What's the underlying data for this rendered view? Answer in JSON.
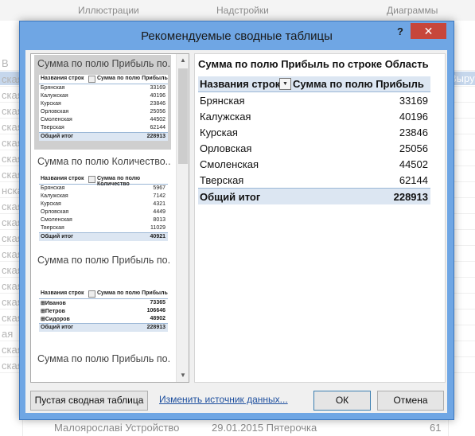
{
  "background": {
    "ribbon_groups": [
      "Иллюстрации",
      "Надстройки",
      "Диаграммы"
    ],
    "left_cells": [
      "В",
      "ская",
      "ская",
      "ская",
      "ская",
      "ская",
      "ская",
      "ская",
      "нская",
      "ская",
      "ская",
      "ская",
      "ская",
      "ская",
      "ская",
      "ская",
      "ская",
      "ая",
      "ская",
      "ская"
    ],
    "right_cell": "Выру",
    "bottom_row": {
      "c1": "Малоярославі Устройство",
      "c2": "29.01.2015 Пятерочка",
      "c3": "61"
    }
  },
  "dialog": {
    "title": "Рекомендуемые сводные таблицы",
    "help": "?",
    "close": "✕"
  },
  "cards": [
    {
      "title": "Сумма по полю Прибыль по...",
      "head": [
        "Названия строк",
        "Сумма по полю Прибыль"
      ],
      "rows": [
        [
          "Брянская",
          "33169"
        ],
        [
          "Калужская",
          "40196"
        ],
        [
          "Курская",
          "23846"
        ],
        [
          "Орловская",
          "25056"
        ],
        [
          "Смоленская",
          "44502"
        ],
        [
          "Тверская",
          "62144"
        ]
      ],
      "total": [
        "Общий итог",
        "228913"
      ]
    },
    {
      "title": "Сумма по полю Количество...",
      "head": [
        "Названия строк",
        "Сумма по полю Количество"
      ],
      "rows": [
        [
          "Брянская",
          "5967"
        ],
        [
          "Калужская",
          "7142"
        ],
        [
          "Курская",
          "4321"
        ],
        [
          "Орловская",
          "4449"
        ],
        [
          "Смоленская",
          "8013"
        ],
        [
          "Тверская",
          "11029"
        ]
      ],
      "total": [
        "Общий итог",
        "40921"
      ]
    },
    {
      "title": "Сумма по полю Прибыль по...",
      "head": [
        "Названия строк",
        "Сумма по полю Прибыль"
      ],
      "rows": [
        [
          "⊞Иванов",
          "73365"
        ],
        [
          "⊞Петров",
          "106646"
        ],
        [
          "⊞Сидоров",
          "48902"
        ]
      ],
      "total": [
        "Общий итог",
        "228913"
      ]
    },
    {
      "title": "Сумма по полю Прибыль по..."
    }
  ],
  "preview": {
    "title": "Сумма по полю Прибыль по строке Область",
    "head": [
      "Названия строк",
      "Сумма по полю Прибыль"
    ],
    "filter_glyph": "▼",
    "rows": [
      [
        "Брянская",
        "33169"
      ],
      [
        "Калужская",
        "40196"
      ],
      [
        "Курская",
        "23846"
      ],
      [
        "Орловская",
        "25056"
      ],
      [
        "Смоленская",
        "44502"
      ],
      [
        "Тверская",
        "62144"
      ]
    ],
    "total": [
      "Общий итог",
      "228913"
    ]
  },
  "buttons": {
    "blank": "Пустая сводная таблица",
    "change_source": "Изменить источник данных...",
    "ok": "ОК",
    "cancel": "Отмена"
  },
  "scroll": {
    "up": "▲",
    "down": "▼"
  }
}
